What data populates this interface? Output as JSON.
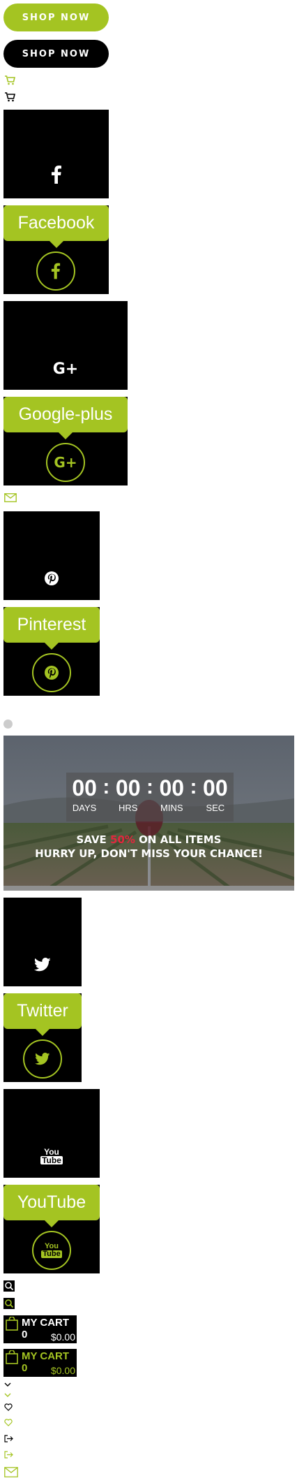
{
  "shop_buttons": [
    {
      "label": "SHOP NOW",
      "bg": "#a4c422",
      "fg": "#ffffff"
    },
    {
      "label": "SHOP NOW",
      "bg": "#000000",
      "fg": "#ffffff"
    }
  ],
  "cart_icons": [
    {
      "icon": "cart-icon",
      "color": "#a4c422"
    },
    {
      "icon": "cart-icon",
      "color": "#000000"
    }
  ],
  "social": {
    "facebook": {
      "label": "Facebook",
      "icon": "facebook-icon"
    },
    "google_plus": {
      "label": "Google-plus",
      "icon": "google-plus-icon"
    },
    "pinterest": {
      "label": "Pinterest",
      "icon": "pinterest-icon"
    },
    "twitter": {
      "label": "Twitter",
      "icon": "twitter-icon"
    },
    "youtube": {
      "label": "YouTube",
      "icon": "youtube-icon",
      "glyph_top": "You",
      "glyph_bottom": "Tube"
    }
  },
  "mail_icon": {
    "icon": "mail-icon",
    "color": "#a4c422"
  },
  "dot": {
    "icon": "dot-icon",
    "color": "#cccccc"
  },
  "promo": {
    "countdown": [
      {
        "value": "00",
        "label": "DAYS"
      },
      {
        "value": "00",
        "label": "HRS"
      },
      {
        "value": "00",
        "label": "MINS"
      },
      {
        "value": "00",
        "label": "SEC"
      }
    ],
    "separator": ":",
    "line1_before": "SAVE",
    "line1_highlight": "50%",
    "line1_after": "ON ALL ITEMS",
    "line2": "HURRY UP, DON'T MISS YOUR CHANCE!",
    "highlight_color": "#e3263d"
  },
  "search_icons": [
    {
      "icon": "search-icon",
      "color": "#000000"
    },
    {
      "icon": "search-icon",
      "color": "#a4c422"
    }
  ],
  "carts": [
    {
      "title": "MY CART 0",
      "price": "$0.00",
      "title_color": "#ffffff",
      "price_color": "#ffffff",
      "icon_color": "#a4c422"
    },
    {
      "title": "MY CART 0",
      "price": "$0.00",
      "title_color": "#a4c422",
      "price_color": "#a4c422",
      "icon_color": "#a4c422"
    }
  ],
  "misc_icons": [
    {
      "icon": "chevron-down-icon",
      "color": "#000000"
    },
    {
      "icon": "chevron-down-icon",
      "color": "#a4c422"
    },
    {
      "icon": "heart-icon",
      "color": "#000000"
    },
    {
      "icon": "heart-icon",
      "color": "#a4c422"
    },
    {
      "icon": "logout-icon",
      "color": "#000000"
    },
    {
      "icon": "logout-icon",
      "color": "#a4c422"
    },
    {
      "icon": "mail-icon",
      "color": "#a4c422"
    }
  ],
  "accent": "#a4c422"
}
